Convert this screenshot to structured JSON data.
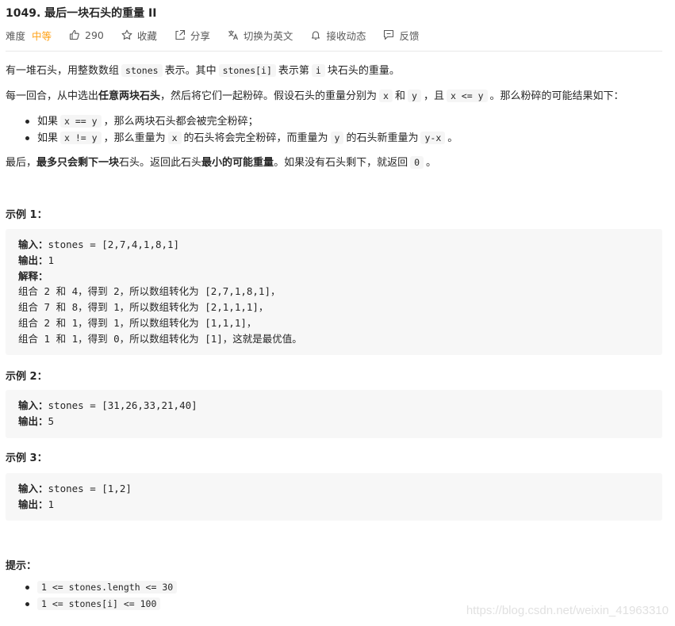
{
  "problem": {
    "title": "1049. 最后一块石头的重量 II",
    "difficulty_label": "难度",
    "difficulty_value": "中等",
    "likes": "290",
    "actions": {
      "favorite": "收藏",
      "share": "分享",
      "translate": "切换为英文",
      "subscribe": "接收动态",
      "feedback": "反馈"
    }
  },
  "colors": {
    "difficulty": "#ffa116",
    "code_bg": "#f7f7f7",
    "text": "#262626"
  },
  "description": {
    "p1": {
      "t1": "有一堆石头，用整数数组",
      "c1": "stones",
      "t2": "表示。其中",
      "c2": "stones[i]",
      "t3": "表示第",
      "c3": "i",
      "t4": "块石头的重量。"
    },
    "p2": {
      "t1": "每一回合，从中选出",
      "b1": "任意两块石头",
      "t2": "，然后将它们一起粉碎。假设石头的重量分别为",
      "c1": "x",
      "t3": "和",
      "c2": "y",
      "t4": "，且",
      "c3": "x <= y",
      "t5": "。那么粉碎的可能结果如下："
    },
    "bullet1": {
      "t1": "如果",
      "c1": "x == y",
      "t2": "，那么两块石头都会被完全粉碎；"
    },
    "bullet2": {
      "t1": "如果",
      "c1": "x != y",
      "t2": "，那么重量为",
      "c2": "x",
      "t3": "的石头将会完全粉碎，而重量为",
      "c3": "y",
      "t4": "的石头新重量为",
      "c4": "y-x",
      "t5": "。"
    },
    "p3": {
      "t1": "最后，",
      "b1": "最多只会剩下一块",
      "t2": "石头。返回此石头",
      "b2": "最小的可能重量",
      "t3": "。如果没有石头剩下，就返回",
      "c1": "0",
      "t4": "。"
    }
  },
  "examples": [
    {
      "heading": "示例 1：",
      "input_label": "输入：",
      "input": "stones = [2,7,4,1,8,1]",
      "output_label": "输出：",
      "output": "1",
      "explain_label": "解释：",
      "explain": [
        "组合 2 和 4，得到 2，所以数组转化为 [2,7,1,8,1]，",
        "组合 7 和 8，得到 1，所以数组转化为 [2,1,1,1]，",
        "组合 2 和 1，得到 1，所以数组转化为 [1,1,1]，",
        "组合 1 和 1，得到 0，所以数组转化为 [1]，这就是最优值。"
      ]
    },
    {
      "heading": "示例 2：",
      "input_label": "输入：",
      "input": "stones = [31,26,33,21,40]",
      "output_label": "输出：",
      "output": "5"
    },
    {
      "heading": "示例 3：",
      "input_label": "输入：",
      "input": "stones = [1,2]",
      "output_label": "输出：",
      "output": "1"
    }
  ],
  "hints": {
    "heading": "提示：",
    "items": [
      "1 <= stones.length <= 30",
      "1 <= stones[i] <= 100"
    ]
  },
  "watermark": "https://blog.csdn.net/weixin_41963310",
  "icons": [
    "thumbs-up-icon",
    "star-icon",
    "share-icon",
    "translate-icon",
    "bell-icon",
    "feedback-icon"
  ]
}
